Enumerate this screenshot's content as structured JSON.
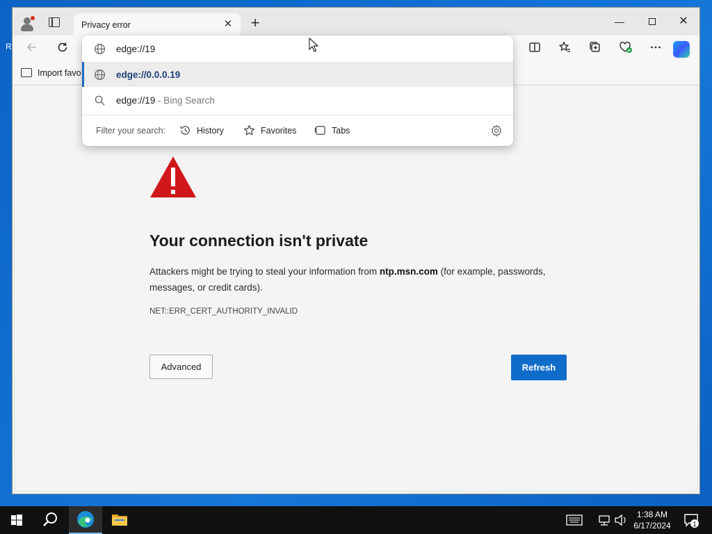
{
  "desktop": {
    "edge_letter": "R"
  },
  "browser": {
    "tab": {
      "title": "Privacy error",
      "close_glyph": "✕"
    },
    "new_tab_glyph": "+",
    "window_controls": {
      "minimize": "—",
      "close": "✕"
    },
    "favorites_bar": {
      "import_label": "Import favo"
    }
  },
  "omnibox": {
    "input_value": "edge://19",
    "suggestions": [
      {
        "text": "edge://0.0.0.19",
        "icon": "globe-icon",
        "selected": true
      },
      {
        "text": "edge://19",
        "hint": " - Bing Search",
        "icon": "search-icon"
      }
    ],
    "filter_label": "Filter your search:",
    "filters": [
      {
        "label": "History",
        "icon": "history-icon"
      },
      {
        "label": "Favorites",
        "icon": "star-icon"
      },
      {
        "label": "Tabs",
        "icon": "tabs-icon"
      }
    ]
  },
  "error_page": {
    "heading": "Your connection isn't private",
    "desc_before": "Attackers might be trying to steal your information from ",
    "host": "ntp.msn.com",
    "desc_after": " (for example, passwords, messages, or credit cards).",
    "error_code": "NET::ERR_CERT_AUTHORITY_INVALID",
    "advanced_label": "Advanced",
    "refresh_label": "Refresh",
    "accent_color": "#0f6cc8",
    "warning_color": "#d0181b"
  },
  "taskbar": {
    "time": "1:38 AM",
    "date": "6/17/2024",
    "notification_count": "1"
  }
}
